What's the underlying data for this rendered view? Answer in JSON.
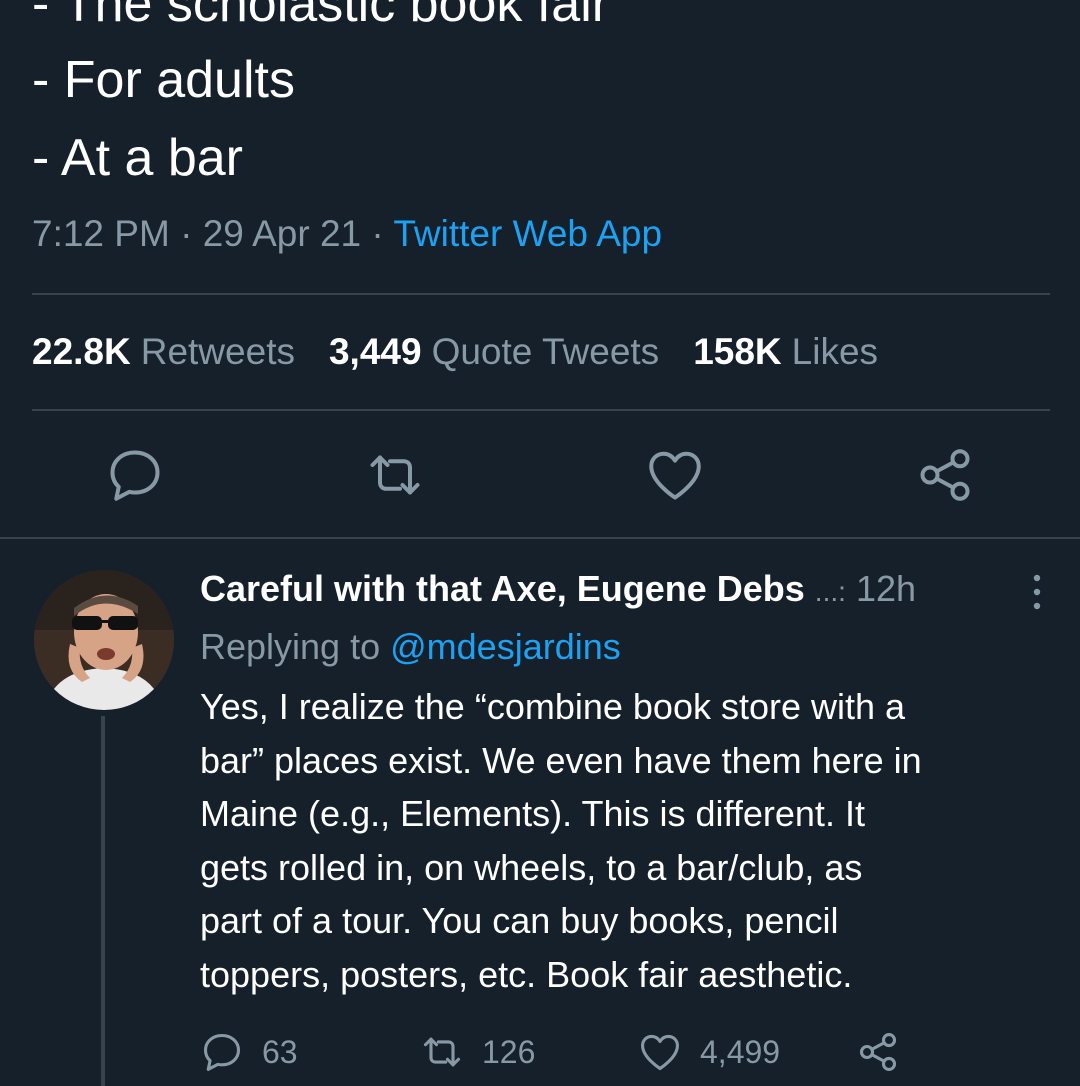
{
  "tweet": {
    "lines": [
      "- The scholastic book fair",
      "- For adults",
      "- At a bar"
    ],
    "time": "7:12 PM",
    "date": "29 Apr 21",
    "separator": "·",
    "source": "Twitter Web App",
    "stats": {
      "retweets_count": "22.8K",
      "retweets_label": "Retweets",
      "quotes_count": "3,449",
      "quotes_label": "Quote Tweets",
      "likes_count": "158K",
      "likes_label": "Likes"
    },
    "actions": [
      "reply-icon",
      "retweet-icon",
      "like-icon",
      "share-icon"
    ]
  },
  "reply": {
    "author_name": "Careful with that Axe, Eugene Debs",
    "author_handle_truncated": "...:",
    "time": "12h",
    "replying_prefix": "Replying to",
    "replying_mention": "@mdesjardins",
    "body_lines": [
      "Yes, I realize the “combine book store with a",
      "bar” places exist. We even have them here in",
      "Maine (e.g., Elements). This is different. It",
      "gets rolled in, on wheels, to a bar/club, as",
      "part of a tour. You can buy books, pencil",
      "toppers, posters, etc. Book fair aesthetic."
    ],
    "counts": {
      "replies": "63",
      "retweets": "126",
      "likes": "4,499"
    }
  },
  "colors": {
    "background": "#15202b",
    "text": "#ffffff",
    "secondary": "#8899a6",
    "link": "#1da1f2",
    "divider": "#38444d"
  }
}
